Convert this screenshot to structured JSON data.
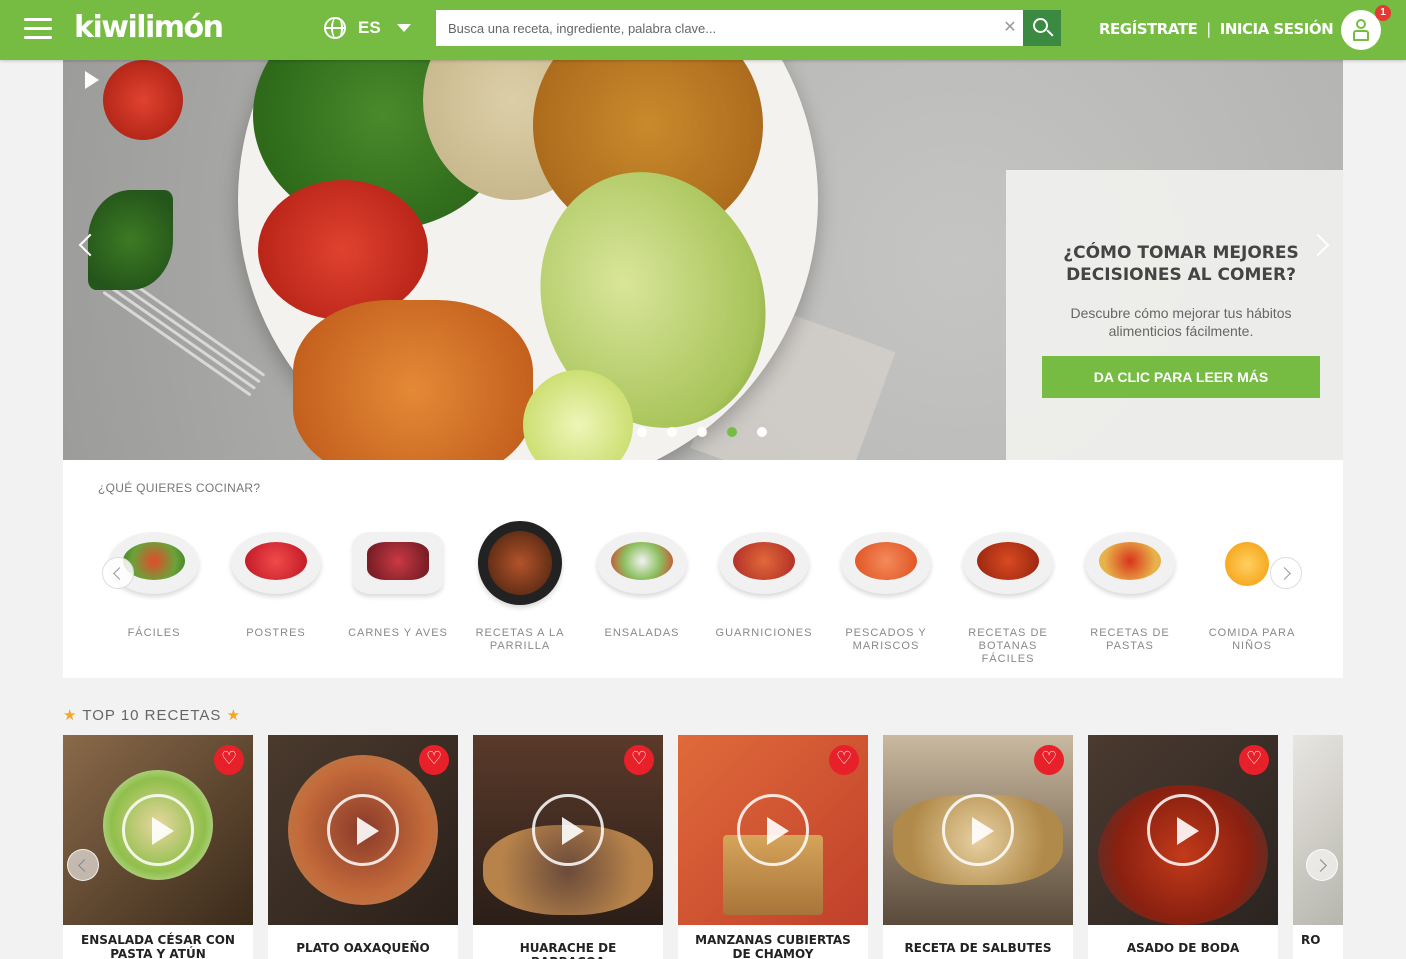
{
  "header": {
    "logo": "kiwilimón",
    "language": "ES",
    "search_placeholder": "Busca una receta, ingrediente, palabra clave...",
    "register": "REGÍSTRATE",
    "separator": "|",
    "login": "INICIA SESIÓN",
    "notification_count": "1",
    "brand_color": "#76bc43",
    "search_button_color": "#3b8a41"
  },
  "hero": {
    "title": "¿CÓMO TOMAR MEJORES DECISIONES AL COMER?",
    "description": "Descubre cómo mejorar tus hábitos alimenticios fácilmente.",
    "cta": "DA CLIC PARA LEER MÁS",
    "slide_count": 5,
    "active_slide": 4
  },
  "categories": {
    "heading": "¿QUÉ QUIERES COCINAR?",
    "items": [
      {
        "label": "FÁCILES",
        "icon": "salad-bowl-icon"
      },
      {
        "label": "POSTRES",
        "icon": "strawberries-icon"
      },
      {
        "label": "CARNES Y AVES",
        "icon": "meat-icon"
      },
      {
        "label": "RECETAS A LA PARRILLA",
        "icon": "grill-icon"
      },
      {
        "label": "ENSALADAS",
        "icon": "salad-plate-icon"
      },
      {
        "label": "GUARNICIONES",
        "icon": "ratatouille-icon"
      },
      {
        "label": "PESCADOS Y MARISCOS",
        "icon": "salmon-icon"
      },
      {
        "label": "RECETAS DE BOTANAS FÁCILES",
        "icon": "wings-icon"
      },
      {
        "label": "RECETAS DE PASTAS",
        "icon": "pasta-icon"
      },
      {
        "label": "COMIDA PARA NIÑOS",
        "icon": "fruit-icon"
      }
    ]
  },
  "top10": {
    "title": "TOP 10 RECETAS",
    "star": "★",
    "recipes": [
      {
        "title": "ENSALADA CÉSAR CON PASTA Y ATÚN"
      },
      {
        "title": "PLATO OAXAQUEÑO"
      },
      {
        "title": "HUARACHE DE BARBACOA"
      },
      {
        "title": "MANZANAS CUBIERTAS DE CHAMOY"
      },
      {
        "title": "RECETA DE SALBUTES"
      },
      {
        "title": "ASADO DE BODA"
      },
      {
        "title": "RO"
      }
    ]
  }
}
